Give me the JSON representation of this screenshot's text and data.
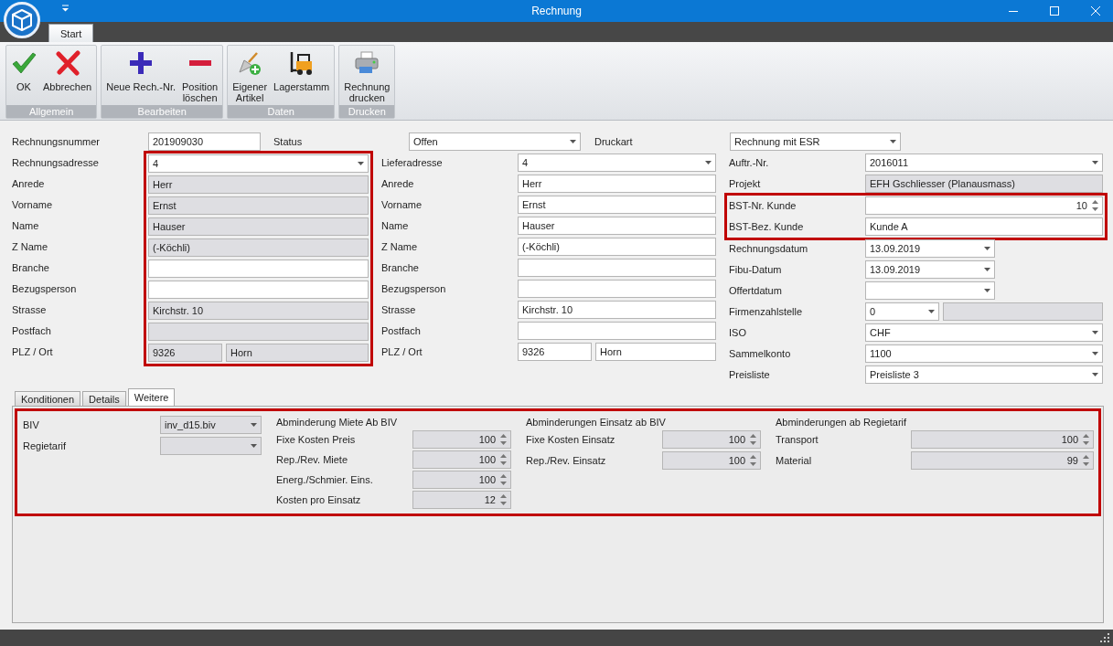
{
  "window": {
    "title": "Rechnung"
  },
  "ribbon": {
    "tabs": [
      {
        "label": "Start",
        "selected": true
      }
    ],
    "groups": [
      {
        "label": "Allgemein",
        "buttons": [
          {
            "kind": "ok",
            "label": "OK"
          },
          {
            "kind": "cancel",
            "label": "Abbrechen"
          }
        ]
      },
      {
        "label": "Bearbeiten",
        "buttons": [
          {
            "kind": "add",
            "label": "Neue Rech.-Nr."
          },
          {
            "kind": "remove",
            "label": "Position\nlöschen"
          }
        ]
      },
      {
        "label": "Daten",
        "buttons": [
          {
            "kind": "article",
            "label": "Eigener\nArtikel"
          },
          {
            "kind": "stock",
            "label": "Lagerstamm"
          }
        ]
      },
      {
        "label": "Drucken",
        "buttons": [
          {
            "kind": "print",
            "label": "Rechnung\ndrucken"
          }
        ]
      }
    ]
  },
  "header_row": [
    {
      "label": "Rechnungsnummer",
      "field": {
        "kind": "text",
        "value": "201909030",
        "readonly": false
      }
    },
    {
      "label": "Status",
      "field": {
        "kind": "combo",
        "value": "Offen",
        "readonly": false
      }
    },
    {
      "label": "Druckart",
      "field": {
        "kind": "combo",
        "value": "Rechnung mit ESR",
        "readonly": false
      }
    }
  ],
  "columns": [
    {
      "sections": [
        {
          "highlighted": false,
          "fields_highlighted": true,
          "rows": [
            {
              "label": "Rechnungsadresse",
              "field": {
                "kind": "combo",
                "value": "4",
                "readonly": false
              }
            },
            {
              "label": "Anrede",
              "field": {
                "kind": "text",
                "value": "Herr",
                "readonly": true
              }
            },
            {
              "label": "Vorname",
              "field": {
                "kind": "text",
                "value": "Ernst",
                "readonly": true
              }
            },
            {
              "label": "Name",
              "field": {
                "kind": "text",
                "value": "Hauser",
                "readonly": true
              }
            },
            {
              "label": "Z Name",
              "field": {
                "kind": "text",
                "value": "(-Köchli)",
                "readonly": true
              }
            },
            {
              "label": "Branche",
              "field": {
                "kind": "text",
                "readonly": false
              }
            },
            {
              "label": "Bezugsperson",
              "field": {
                "kind": "text",
                "readonly": false
              }
            },
            {
              "label": "Strasse",
              "field": {
                "kind": "text",
                "value": "Kirchstr. 10",
                "readonly": true
              }
            },
            {
              "label": "Postfach",
              "field": {
                "kind": "text",
                "readonly": true
              }
            },
            {
              "label": "PLZ / Ort",
              "field": {
                "kind": "split",
                "parts": [
                  {
                    "kind": "text",
                    "value": "9326",
                    "readonly": true
                  },
                  {
                    "kind": "text",
                    "value": "Horn",
                    "readonly": true
                  }
                ]
              }
            }
          ]
        }
      ]
    },
    {
      "sections": [
        {
          "highlighted": false,
          "fields_highlighted": false,
          "rows": [
            {
              "label": "Lieferadresse",
              "field": {
                "kind": "combo",
                "value": "4",
                "readonly": false
              }
            },
            {
              "label": "Anrede",
              "field": {
                "kind": "text",
                "value": "Herr",
                "readonly": false
              }
            },
            {
              "label": "Vorname",
              "field": {
                "kind": "text",
                "value": "Ernst",
                "readonly": false
              }
            },
            {
              "label": "Name",
              "field": {
                "kind": "text",
                "value": "Hauser",
                "readonly": false
              }
            },
            {
              "label": "Z Name",
              "field": {
                "kind": "text",
                "value": "(-Köchli)",
                "readonly": false
              }
            },
            {
              "label": "Branche",
              "field": {
                "kind": "text",
                "readonly": false
              }
            },
            {
              "label": "Bezugsperson",
              "field": {
                "kind": "text",
                "readonly": false
              }
            },
            {
              "label": "Strasse",
              "field": {
                "kind": "text",
                "value": "Kirchstr. 10",
                "readonly": false
              }
            },
            {
              "label": "Postfach",
              "field": {
                "kind": "text",
                "readonly": false
              }
            },
            {
              "label": "PLZ / Ort",
              "field": {
                "kind": "split",
                "parts": [
                  {
                    "kind": "text",
                    "value": "9326",
                    "readonly": false
                  },
                  {
                    "kind": "text",
                    "value": "Horn",
                    "readonly": false
                  }
                ]
              }
            }
          ]
        }
      ]
    },
    {
      "sections": [
        {
          "highlighted": false,
          "fields_highlighted": false,
          "rows": [
            {
              "label": "Auftr.-Nr.",
              "field": {
                "kind": "combo",
                "value": "2016011",
                "readonly": false
              }
            },
            {
              "label": "Projekt",
              "field": {
                "kind": "text",
                "value": "EFH Gschliesser (Planausmass)",
                "readonly": true
              }
            }
          ]
        },
        {
          "highlighted": true,
          "fields_highlighted": false,
          "rows": [
            {
              "label": "BST-Nr. Kunde",
              "field": {
                "kind": "spin",
                "value": "10",
                "readonly": false
              }
            },
            {
              "label": "BST-Bez. Kunde",
              "field": {
                "kind": "text",
                "value": "Kunde A",
                "readonly": false
              }
            }
          ]
        },
        {
          "highlighted": false,
          "fields_highlighted": false,
          "rows": [
            {
              "label": "Rechnungsdatum",
              "field": {
                "kind": "date",
                "value": "13.09.2019",
                "readonly": false
              }
            },
            {
              "label": "Fibu-Datum",
              "field": {
                "kind": "date",
                "value": "13.09.2019",
                "readonly": false
              }
            },
            {
              "label": "Offertdatum",
              "field": {
                "kind": "date",
                "readonly": false
              }
            },
            {
              "label": "Firmenzahlstelle",
              "field": {
                "kind": "split",
                "parts": [
                  {
                    "kind": "combo",
                    "value": "0",
                    "readonly": false
                  },
                  {
                    "kind": "text",
                    "readonly": true
                  }
                ]
              }
            },
            {
              "label": "ISO",
              "field": {
                "kind": "combo",
                "value": "CHF",
                "readonly": false
              }
            },
            {
              "label": "Sammelkonto",
              "field": {
                "kind": "combo",
                "value": "1100",
                "readonly": false
              }
            },
            {
              "label": "Preisliste",
              "field": {
                "kind": "combo",
                "value": "Preisliste 3",
                "readonly": false
              }
            }
          ]
        }
      ]
    }
  ],
  "detail_tabs": [
    {
      "label": "Konditionen",
      "selected": false
    },
    {
      "label": "Details",
      "selected": false
    },
    {
      "label": "Weitere",
      "selected": true
    }
  ],
  "detail_panel": {
    "highlighted": true,
    "groups": [
      {
        "rows": [
          {
            "label": "BIV",
            "field": {
              "kind": "combo",
              "value": "inv_d15.biv",
              "readonly": true
            }
          },
          {
            "label": "Regietarif",
            "field": {
              "kind": "combo",
              "readonly": true
            }
          }
        ]
      },
      {
        "title": "Abminderung Miete Ab BIV",
        "rows": [
          {
            "label": "Fixe Kosten Preis",
            "field": {
              "kind": "spin",
              "value": "100",
              "readonly": true
            }
          },
          {
            "label": "Rep./Rev. Miete",
            "field": {
              "kind": "spin",
              "value": "100",
              "readonly": true
            }
          },
          {
            "label": "Energ./Schmier. Eins.",
            "field": {
              "kind": "spin",
              "value": "100",
              "readonly": true
            }
          },
          {
            "label": "Kosten pro Einsatz",
            "field": {
              "kind": "spin",
              "value": "12",
              "readonly": true
            }
          }
        ]
      },
      {
        "title": "Abminderungen Einsatz ab BIV",
        "rows": [
          {
            "label": "Fixe Kosten Einsatz",
            "field": {
              "kind": "spin",
              "value": "100",
              "readonly": true
            }
          },
          {
            "label": "Rep./Rev. Einsatz",
            "field": {
              "kind": "spin",
              "value": "100",
              "readonly": true
            }
          }
        ]
      },
      {
        "title": "Abminderungen ab Regietarif",
        "rows": [
          {
            "label": "Transport",
            "field": {
              "kind": "spin",
              "value": "100",
              "readonly": true
            }
          },
          {
            "label": "Material",
            "field": {
              "kind": "spin",
              "value": "99",
              "readonly": true
            }
          }
        ]
      }
    ]
  }
}
